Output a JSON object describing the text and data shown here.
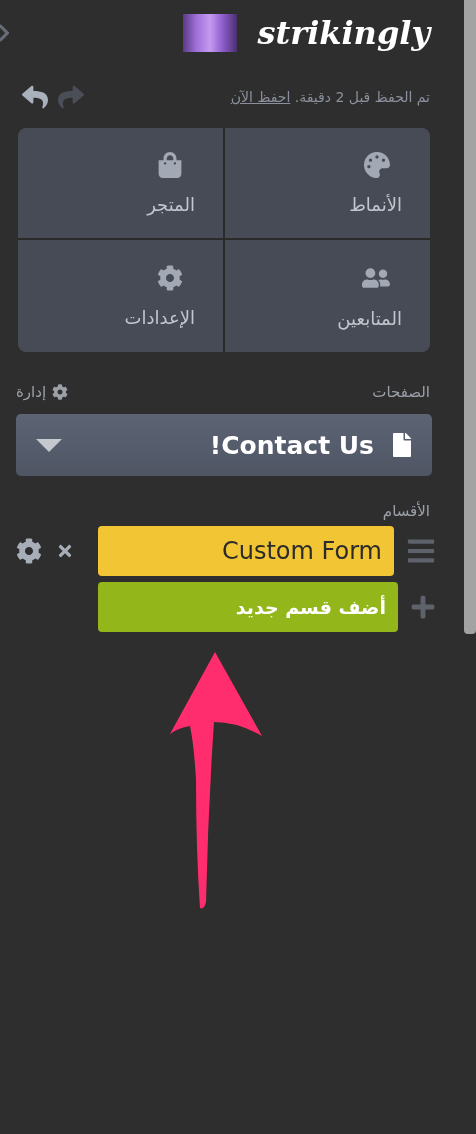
{
  "logo": {
    "text": "strikingly"
  },
  "history": {
    "undo": {
      "disabled": false
    },
    "redo": {
      "disabled": true
    }
  },
  "save_status": {
    "text": "تم الحفظ قبل 2 دقيقة.",
    "link": "احفظ الآن"
  },
  "tiles": [
    {
      "label": "الأنماط",
      "kind": "palette"
    },
    {
      "label": "المتجر",
      "kind": "store"
    },
    {
      "label": "المتابعين",
      "kind": "people"
    },
    {
      "label": "الإعدادات",
      "kind": "settings"
    }
  ],
  "pages": {
    "label": "الصفحات",
    "manage": "إدارة",
    "current": "Contact Us!"
  },
  "sections": {
    "label": "الأقسام",
    "items": [
      {
        "name": "Custom Form"
      }
    ],
    "add": "أضف قسم جديد"
  }
}
